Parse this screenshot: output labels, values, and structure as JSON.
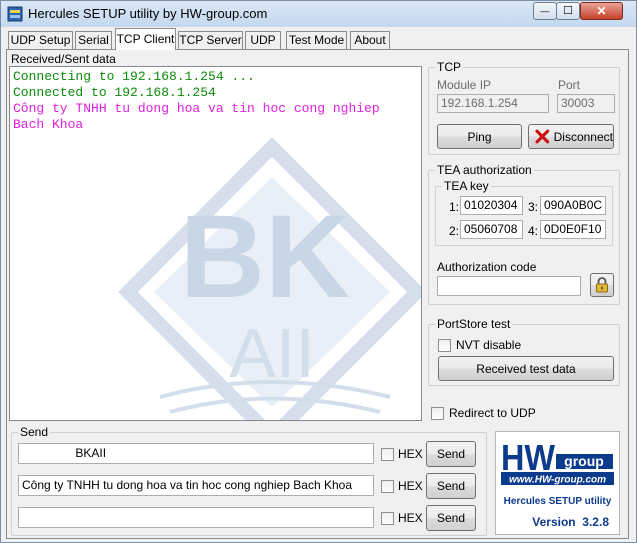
{
  "window": {
    "title": "Hercules SETUP utility by HW-group.com",
    "minimize_glyph": "—",
    "maximize_glyph": "☐",
    "close_glyph": "✕"
  },
  "tabs": [
    "UDP Setup",
    "Serial",
    "TCP Client",
    "TCP Server",
    "UDP",
    "Test Mode",
    "About"
  ],
  "active_tab": "TCP Client",
  "received": {
    "label": "Received/Sent data",
    "lines": [
      {
        "text": "Connecting to 192.168.1.254 ...",
        "color": "#0a8c0a"
      },
      {
        "text": "Connected to 192.168.1.254",
        "color": "#0a8c0a"
      },
      {
        "text": "Công ty TNHH tu dong hoa va tin hoc cong nghiep",
        "color": "#e01fe0"
      },
      {
        "text": "Bach Khoa",
        "color": "#e01fe0"
      }
    ]
  },
  "watermark": {
    "line1": "BK",
    "line2": "AII"
  },
  "tcp": {
    "title": "TCP",
    "module_ip_label": "Module IP",
    "module_ip": "192.168.1.254",
    "port_label": "Port",
    "port": "30003",
    "ping_label": "Ping",
    "disconnect_label": "Disconnect"
  },
  "tea": {
    "title": "TEA authorization",
    "key_title": "TEA key",
    "keys": [
      {
        "n": "1:",
        "v": "01020304"
      },
      {
        "n": "3:",
        "v": "090A0B0C"
      },
      {
        "n": "2:",
        "v": "05060708"
      },
      {
        "n": "4:",
        "v": "0D0E0F10"
      }
    ],
    "auth_label": "Authorization code",
    "auth_value": ""
  },
  "portstore": {
    "title": "PortStore test",
    "nvt_label": "NVT disable",
    "received_test_label": "Received test data"
  },
  "redirect_label": "Redirect to UDP",
  "send": {
    "title": "Send",
    "rows": [
      {
        "value": "                BKAII",
        "hex_label": "HEX",
        "send_label": "Send"
      },
      {
        "value": "Công ty TNHH tu dong hoa va tin hoc cong nghiep Bach Khoa",
        "hex_label": "HEX",
        "send_label": "Send"
      },
      {
        "value": "",
        "hex_label": "HEX",
        "send_label": "Send"
      }
    ]
  },
  "logo": {
    "hw": "HW",
    "group": "group",
    "url": "www.HW-group.com",
    "product": "Hercules SETUP utility",
    "version": "Version  3.2.8"
  },
  "colors": {
    "accent": "#0c3a8c",
    "connected_text": "#0a8c0a",
    "data_text": "#e01fe0",
    "watermark": "#dbe4ef",
    "disconnect_x": "#cc1111"
  },
  "icons": [
    "app-icon",
    "disconnect-x-icon",
    "lock-icon"
  ]
}
